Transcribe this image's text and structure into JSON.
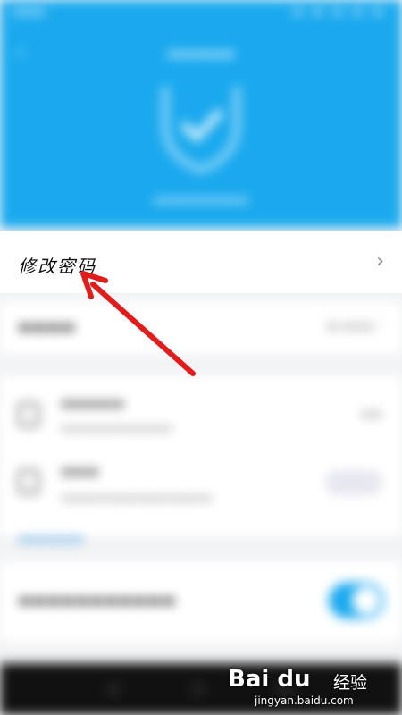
{
  "password_row": {
    "label": "修改密码",
    "chevron": "›"
  },
  "watermark": {
    "logo": "Bai du",
    "text": "经验",
    "url": "jingyan.baidu.com"
  },
  "colors": {
    "header": "#1aa9ee",
    "arrow": "#e21b1b",
    "accent": "#1aa9ee"
  },
  "icons": [
    "back-icon",
    "shield-check-icon",
    "chevron-right-icon",
    "device-icon",
    "toggle-switch"
  ]
}
